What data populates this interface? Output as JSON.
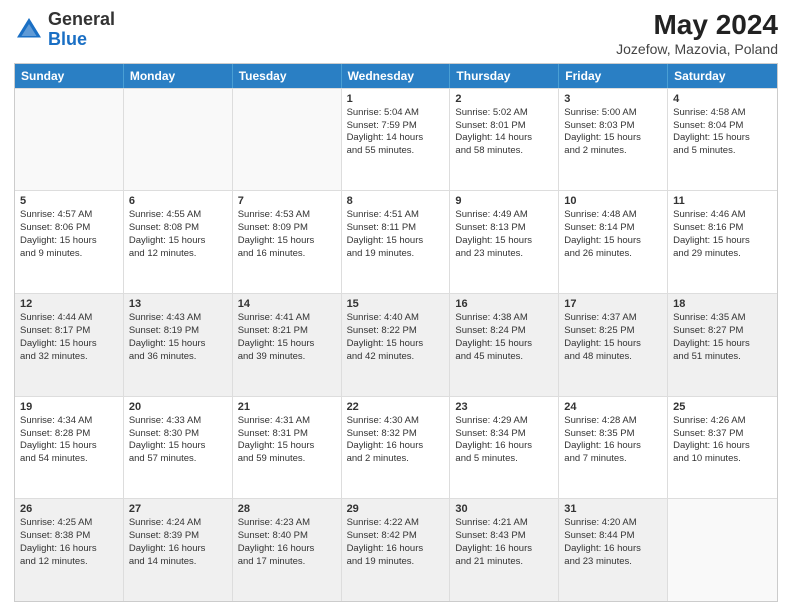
{
  "header": {
    "logo_general": "General",
    "logo_blue": "Blue",
    "main_title": "May 2024",
    "subtitle": "Jozefow, Mazovia, Poland"
  },
  "days_of_week": [
    "Sunday",
    "Monday",
    "Tuesday",
    "Wednesday",
    "Thursday",
    "Friday",
    "Saturday"
  ],
  "weeks": [
    [
      {
        "day": "",
        "empty": true,
        "lines": []
      },
      {
        "day": "",
        "empty": true,
        "lines": []
      },
      {
        "day": "",
        "empty": true,
        "lines": []
      },
      {
        "day": "1",
        "empty": false,
        "lines": [
          "Sunrise: 5:04 AM",
          "Sunset: 7:59 PM",
          "Daylight: 14 hours",
          "and 55 minutes."
        ]
      },
      {
        "day": "2",
        "empty": false,
        "lines": [
          "Sunrise: 5:02 AM",
          "Sunset: 8:01 PM",
          "Daylight: 14 hours",
          "and 58 minutes."
        ]
      },
      {
        "day": "3",
        "empty": false,
        "lines": [
          "Sunrise: 5:00 AM",
          "Sunset: 8:03 PM",
          "Daylight: 15 hours",
          "and 2 minutes."
        ]
      },
      {
        "day": "4",
        "empty": false,
        "lines": [
          "Sunrise: 4:58 AM",
          "Sunset: 8:04 PM",
          "Daylight: 15 hours",
          "and 5 minutes."
        ]
      }
    ],
    [
      {
        "day": "5",
        "empty": false,
        "lines": [
          "Sunrise: 4:57 AM",
          "Sunset: 8:06 PM",
          "Daylight: 15 hours",
          "and 9 minutes."
        ]
      },
      {
        "day": "6",
        "empty": false,
        "lines": [
          "Sunrise: 4:55 AM",
          "Sunset: 8:08 PM",
          "Daylight: 15 hours",
          "and 12 minutes."
        ]
      },
      {
        "day": "7",
        "empty": false,
        "lines": [
          "Sunrise: 4:53 AM",
          "Sunset: 8:09 PM",
          "Daylight: 15 hours",
          "and 16 minutes."
        ]
      },
      {
        "day": "8",
        "empty": false,
        "lines": [
          "Sunrise: 4:51 AM",
          "Sunset: 8:11 PM",
          "Daylight: 15 hours",
          "and 19 minutes."
        ]
      },
      {
        "day": "9",
        "empty": false,
        "lines": [
          "Sunrise: 4:49 AM",
          "Sunset: 8:13 PM",
          "Daylight: 15 hours",
          "and 23 minutes."
        ]
      },
      {
        "day": "10",
        "empty": false,
        "lines": [
          "Sunrise: 4:48 AM",
          "Sunset: 8:14 PM",
          "Daylight: 15 hours",
          "and 26 minutes."
        ]
      },
      {
        "day": "11",
        "empty": false,
        "lines": [
          "Sunrise: 4:46 AM",
          "Sunset: 8:16 PM",
          "Daylight: 15 hours",
          "and 29 minutes."
        ]
      }
    ],
    [
      {
        "day": "12",
        "empty": false,
        "lines": [
          "Sunrise: 4:44 AM",
          "Sunset: 8:17 PM",
          "Daylight: 15 hours",
          "and 32 minutes."
        ]
      },
      {
        "day": "13",
        "empty": false,
        "lines": [
          "Sunrise: 4:43 AM",
          "Sunset: 8:19 PM",
          "Daylight: 15 hours",
          "and 36 minutes."
        ]
      },
      {
        "day": "14",
        "empty": false,
        "lines": [
          "Sunrise: 4:41 AM",
          "Sunset: 8:21 PM",
          "Daylight: 15 hours",
          "and 39 minutes."
        ]
      },
      {
        "day": "15",
        "empty": false,
        "lines": [
          "Sunrise: 4:40 AM",
          "Sunset: 8:22 PM",
          "Daylight: 15 hours",
          "and 42 minutes."
        ]
      },
      {
        "day": "16",
        "empty": false,
        "lines": [
          "Sunrise: 4:38 AM",
          "Sunset: 8:24 PM",
          "Daylight: 15 hours",
          "and 45 minutes."
        ]
      },
      {
        "day": "17",
        "empty": false,
        "lines": [
          "Sunrise: 4:37 AM",
          "Sunset: 8:25 PM",
          "Daylight: 15 hours",
          "and 48 minutes."
        ]
      },
      {
        "day": "18",
        "empty": false,
        "lines": [
          "Sunrise: 4:35 AM",
          "Sunset: 8:27 PM",
          "Daylight: 15 hours",
          "and 51 minutes."
        ]
      }
    ],
    [
      {
        "day": "19",
        "empty": false,
        "lines": [
          "Sunrise: 4:34 AM",
          "Sunset: 8:28 PM",
          "Daylight: 15 hours",
          "and 54 minutes."
        ]
      },
      {
        "day": "20",
        "empty": false,
        "lines": [
          "Sunrise: 4:33 AM",
          "Sunset: 8:30 PM",
          "Daylight: 15 hours",
          "and 57 minutes."
        ]
      },
      {
        "day": "21",
        "empty": false,
        "lines": [
          "Sunrise: 4:31 AM",
          "Sunset: 8:31 PM",
          "Daylight: 15 hours",
          "and 59 minutes."
        ]
      },
      {
        "day": "22",
        "empty": false,
        "lines": [
          "Sunrise: 4:30 AM",
          "Sunset: 8:32 PM",
          "Daylight: 16 hours",
          "and 2 minutes."
        ]
      },
      {
        "day": "23",
        "empty": false,
        "lines": [
          "Sunrise: 4:29 AM",
          "Sunset: 8:34 PM",
          "Daylight: 16 hours",
          "and 5 minutes."
        ]
      },
      {
        "day": "24",
        "empty": false,
        "lines": [
          "Sunrise: 4:28 AM",
          "Sunset: 8:35 PM",
          "Daylight: 16 hours",
          "and 7 minutes."
        ]
      },
      {
        "day": "25",
        "empty": false,
        "lines": [
          "Sunrise: 4:26 AM",
          "Sunset: 8:37 PM",
          "Daylight: 16 hours",
          "and 10 minutes."
        ]
      }
    ],
    [
      {
        "day": "26",
        "empty": false,
        "lines": [
          "Sunrise: 4:25 AM",
          "Sunset: 8:38 PM",
          "Daylight: 16 hours",
          "and 12 minutes."
        ]
      },
      {
        "day": "27",
        "empty": false,
        "lines": [
          "Sunrise: 4:24 AM",
          "Sunset: 8:39 PM",
          "Daylight: 16 hours",
          "and 14 minutes."
        ]
      },
      {
        "day": "28",
        "empty": false,
        "lines": [
          "Sunrise: 4:23 AM",
          "Sunset: 8:40 PM",
          "Daylight: 16 hours",
          "and 17 minutes."
        ]
      },
      {
        "day": "29",
        "empty": false,
        "lines": [
          "Sunrise: 4:22 AM",
          "Sunset: 8:42 PM",
          "Daylight: 16 hours",
          "and 19 minutes."
        ]
      },
      {
        "day": "30",
        "empty": false,
        "lines": [
          "Sunrise: 4:21 AM",
          "Sunset: 8:43 PM",
          "Daylight: 16 hours",
          "and 21 minutes."
        ]
      },
      {
        "day": "31",
        "empty": false,
        "lines": [
          "Sunrise: 4:20 AM",
          "Sunset: 8:44 PM",
          "Daylight: 16 hours",
          "and 23 minutes."
        ]
      },
      {
        "day": "",
        "empty": true,
        "lines": []
      }
    ]
  ]
}
